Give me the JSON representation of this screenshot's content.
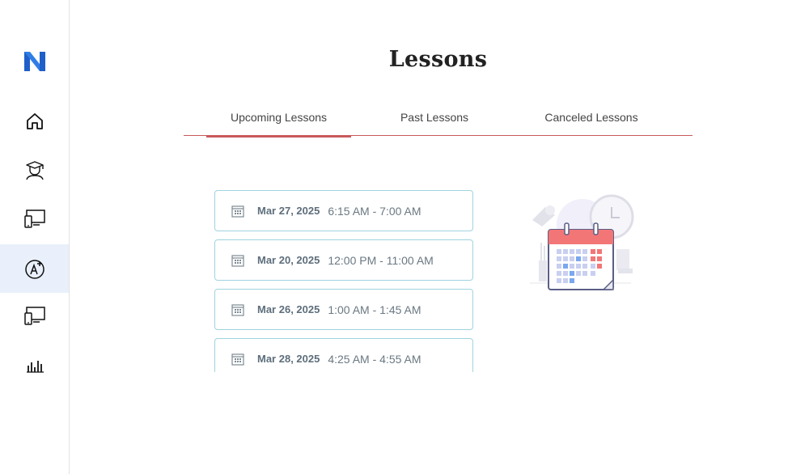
{
  "page": {
    "title": "Lessons"
  },
  "sidebar": {
    "logo": "N",
    "items": [
      {
        "icon": "home-icon",
        "active": false
      },
      {
        "icon": "student-icon",
        "active": false
      },
      {
        "icon": "devices-icon",
        "active": false
      },
      {
        "icon": "add-language-icon",
        "active": true
      },
      {
        "icon": "devices-icon",
        "active": false
      },
      {
        "icon": "bar-chart-icon",
        "active": false
      }
    ]
  },
  "tabs": [
    {
      "label": "Upcoming Lessons",
      "active": true
    },
    {
      "label": "Past Lessons",
      "active": false
    },
    {
      "label": "Canceled Lessons",
      "active": false
    }
  ],
  "lessons": [
    {
      "date": "Mar 27, 2025",
      "time": "6:15 AM - 7:00 AM"
    },
    {
      "date": "Mar 20, 2025",
      "time": "12:00 PM - 11:00 AM"
    },
    {
      "date": "Mar 26, 2025",
      "time": "1:00 AM - 1:45 AM"
    },
    {
      "date": "Mar 28, 2025",
      "time": "4:25 AM - 4:55 AM"
    }
  ],
  "colors": {
    "accent": "#c9595b",
    "card_border": "#9fd3e0",
    "brand": "#2a6fd6",
    "active_nav_bg": "#e9f0fb"
  }
}
